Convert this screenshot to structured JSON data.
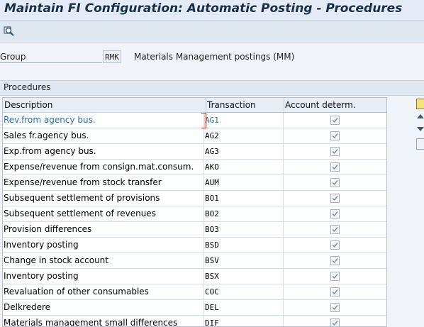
{
  "title": "Maintain FI Configuration: Automatic Posting - Procedures",
  "toolbar": {
    "buttons": [
      {
        "icon": "magnifier-icon"
      }
    ]
  },
  "group": {
    "label": "Group",
    "value": "RMK",
    "description": "Materials Management postings (MM)"
  },
  "section": {
    "title": "Procedures"
  },
  "table": {
    "headers": {
      "description": "Description",
      "transaction": "Transaction",
      "account": "Account determ."
    },
    "rows": [
      {
        "description": "Rev.from agency bus.",
        "transaction": "AG1",
        "checked": true
      },
      {
        "description": "Sales fr.agency bus.",
        "transaction": "AG2",
        "checked": true
      },
      {
        "description": "Exp.from agency bus.",
        "transaction": "AG3",
        "checked": true
      },
      {
        "description": "Expense/revenue from consign.mat.consum.",
        "transaction": "AKO",
        "checked": true
      },
      {
        "description": "Expense/revenue from stock transfer",
        "transaction": "AUM",
        "checked": true
      },
      {
        "description": "Subsequent settlement of provisions",
        "transaction": "BO1",
        "checked": true
      },
      {
        "description": "Subsequent settlement of revenues",
        "transaction": "BO2",
        "checked": true
      },
      {
        "description": "Provision differences",
        "transaction": "BO3",
        "checked": true
      },
      {
        "description": "Inventory posting",
        "transaction": "BSD",
        "checked": true
      },
      {
        "description": "Change in stock account",
        "transaction": "BSV",
        "checked": true
      },
      {
        "description": "Inventory posting",
        "transaction": "BSX",
        "checked": true
      },
      {
        "description": "Revaluation of other consumables",
        "transaction": "COC",
        "checked": true
      },
      {
        "description": "Delkredere",
        "transaction": "DEL",
        "checked": true
      },
      {
        "description": "Materials management small differences",
        "transaction": "DIF",
        "checked": true
      }
    ]
  },
  "colors": {
    "link": "#2b6ea8",
    "focus": "#e03020",
    "header_bg": "#e6edf4"
  }
}
